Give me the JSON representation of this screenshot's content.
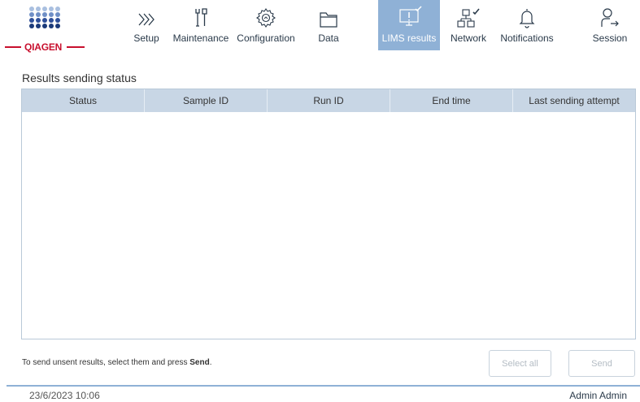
{
  "brand": {
    "logo_text": "QIAGEN",
    "accent": "#c8102e",
    "dot_rows": [
      [
        "#a9bfe0",
        "#a9bfe0",
        "#a9bfe0",
        "#a9bfe0",
        "#a9bfe0"
      ],
      [
        "#6f8fc6",
        "#6f8fc6",
        "#6f8fc6",
        "#6f8fc6",
        "#6f8fc6"
      ],
      [
        "#2e4f9a",
        "#2e4f9a",
        "#2e4f9a",
        "#2e4f9a",
        "#2e4f9a"
      ],
      [
        "#1b3a7a",
        "#1b3a7a",
        "#1b3a7a",
        "#1b3a7a",
        "#1b3a7a"
      ]
    ]
  },
  "nav": {
    "items": [
      {
        "key": "setup",
        "label": "Setup",
        "icon": "chevrons-right-icon"
      },
      {
        "key": "maintenance",
        "label": "Maintenance",
        "icon": "tools-icon"
      },
      {
        "key": "configuration",
        "label": "Configuration",
        "icon": "gear-icon"
      },
      {
        "key": "data",
        "label": "Data",
        "icon": "folder-icon"
      },
      {
        "key": "lims",
        "label": "LIMS results",
        "icon": "monitor-alert-icon",
        "active": true
      },
      {
        "key": "network",
        "label": "Network",
        "icon": "network-icon"
      },
      {
        "key": "notifications",
        "label": "Notifications",
        "icon": "bell-icon"
      },
      {
        "key": "session",
        "label": "Session",
        "icon": "user-logout-icon"
      }
    ],
    "active_color": "#8fb1d6"
  },
  "page": {
    "title": "Results sending status"
  },
  "table": {
    "columns": [
      "Status",
      "Sample ID",
      "Run ID",
      "End time",
      "Last sending attempt"
    ],
    "rows": []
  },
  "hint": {
    "prefix": "To send unsent results, select them and press ",
    "action": "Send",
    "suffix": "."
  },
  "buttons": {
    "select_all": "Select all",
    "send": "Send"
  },
  "statusbar": {
    "datetime": "23/6/2023 10:06",
    "user": "Admin Admin"
  }
}
